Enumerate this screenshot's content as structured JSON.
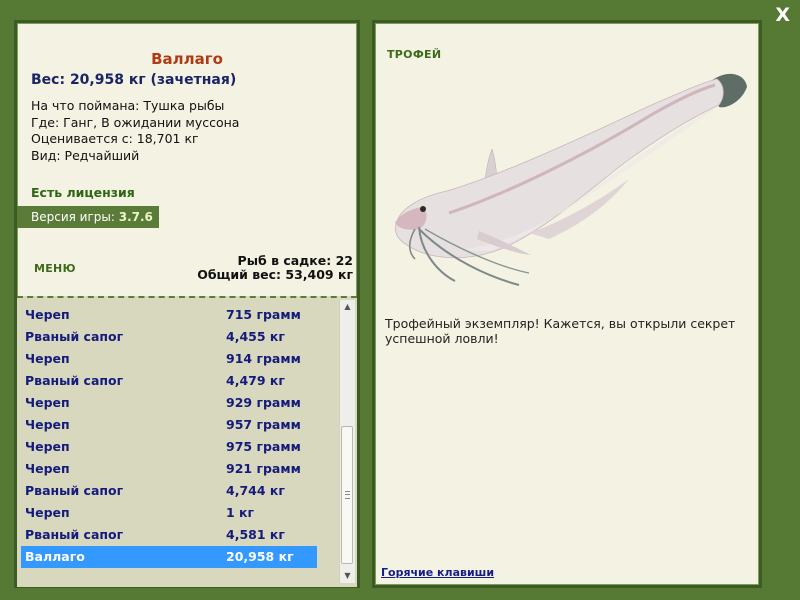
{
  "window": {
    "close_label": "X"
  },
  "fish": {
    "name": "Валлаго",
    "weight_line": "Вес: 20,958 кг (зачетная)",
    "bait": "На что поймана: Тушка рыбы",
    "location": "Где: Ганг, В ожидании муссона",
    "value": "Оценивается с: 18,701 кг",
    "rarity": "Вид: Редчайший"
  },
  "license": "Есть лицензия",
  "version": {
    "label": "Версия игры:",
    "number": "3.7.6"
  },
  "menu_label": "МЕНЮ",
  "stats": {
    "fish_count": "Рыб в садке: 22",
    "total_weight": "Общий вес: 53,409 кг"
  },
  "catch_list": [
    {
      "name": "Череп",
      "weight": "715 грамм"
    },
    {
      "name": "Рваный сапог",
      "weight": "4,455 кг"
    },
    {
      "name": "Череп",
      "weight": "914 грамм"
    },
    {
      "name": "Рваный сапог",
      "weight": "4,479 кг"
    },
    {
      "name": "Череп",
      "weight": "929 грамм"
    },
    {
      "name": "Череп",
      "weight": "957 грамм"
    },
    {
      "name": "Череп",
      "weight": "975 грамм"
    },
    {
      "name": "Череп",
      "weight": "921 грамм"
    },
    {
      "name": "Рваный сапог",
      "weight": "4,744 кг"
    },
    {
      "name": "Череп",
      "weight": "1 кг"
    },
    {
      "name": "Рваный сапог",
      "weight": "4,581 кг"
    },
    {
      "name": "Валлаго",
      "weight": "20,958 кг",
      "selected": true
    }
  ],
  "trophy": {
    "label": "ТРОФЕЙ",
    "description": "Трофейный экземпляр! Кажется, вы открыли секрет успешной ловли!",
    "hotkeys_link": "Горячие клавиши"
  },
  "colors": {
    "background": "#567a34",
    "panel": "#f4f2e2",
    "selection": "#3399ff",
    "fish_name": "#b03a14",
    "list_text": "#151b7c"
  }
}
